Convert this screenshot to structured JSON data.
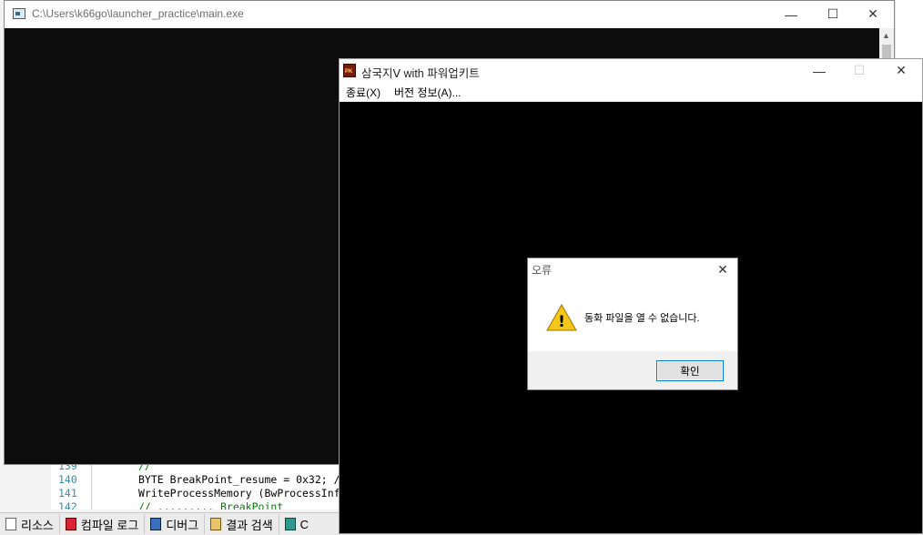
{
  "ide": {
    "code_lines": [
      {
        "num": "139",
        "text": "//"
      },
      {
        "num": "140",
        "text": "BYTE BreakPoint_resume = 0x32; /"
      },
      {
        "num": "141",
        "text": "WriteProcessMemory (BwProcessInf"
      },
      {
        "num": "142",
        "text": "// ......... BreakPoint"
      }
    ],
    "bottom_tabs": [
      {
        "label": "리소스",
        "icon": "resource-icon"
      },
      {
        "label": "컴파일 로그",
        "icon": "compile-log-icon"
      },
      {
        "label": "디버그",
        "icon": "debug-icon"
      },
      {
        "label": "결과 검색",
        "icon": "search-results-icon"
      },
      {
        "label": "C",
        "icon": "class-icon"
      }
    ]
  },
  "console_window": {
    "title": "C:\\Users\\k66go\\launcher_practice\\main.exe",
    "minimize": "—",
    "maximize": "☐",
    "close": "✕",
    "scroll_up": "▲"
  },
  "game_window": {
    "title": "삼국지Ⅴ with 파워업키트",
    "icon_text": "PK",
    "menu": [
      "종료(X)",
      "버전 정보(A)..."
    ],
    "minimize": "—",
    "maximize": "☐",
    "close": "✕"
  },
  "error_dialog": {
    "title": "오류",
    "message": "동화 파일을 열 수 없습니다.",
    "ok_label": "확인",
    "close": "✕",
    "warning_mark": "!"
  },
  "colors": {
    "console_bg": "#0c0c0c",
    "game_bg": "#000000",
    "focus_border": "#0078d7",
    "warning_yellow": "#f5c518"
  }
}
